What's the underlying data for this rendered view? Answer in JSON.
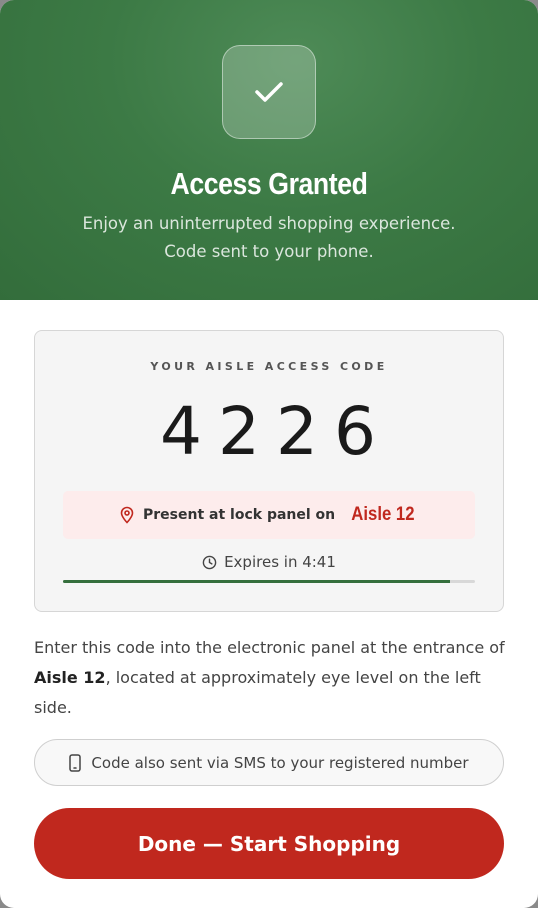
{
  "header": {
    "title": "Access Granted",
    "subtitle_line1": "Enjoy an uninterrupted shopping experience.",
    "subtitle_line2": "Code sent to your phone."
  },
  "code_card": {
    "label": "YOUR AISLE ACCESS CODE",
    "code": "4226",
    "location_prefix": "Present at lock panel on",
    "location_aisle": "Aisle 12",
    "expires_text": "Expires in 4:41",
    "progress_fraction": 0.94
  },
  "instructions": {
    "before": "Enter this code into the electronic panel at the entrance of ",
    "aisle": "Aisle 12",
    "after": ", located at approximately eye level on the left side."
  },
  "sms_notice": "Code also sent via SMS to your registered number",
  "done_button": "Done — Start Shopping",
  "colors": {
    "brand_green": "#3c7a45",
    "accent_red": "#c0281e",
    "location_bg": "#fdecec"
  },
  "icons": {
    "header": "checkmark-icon",
    "location": "map-pin-icon",
    "expires": "clock-icon",
    "sms": "phone-icon"
  }
}
